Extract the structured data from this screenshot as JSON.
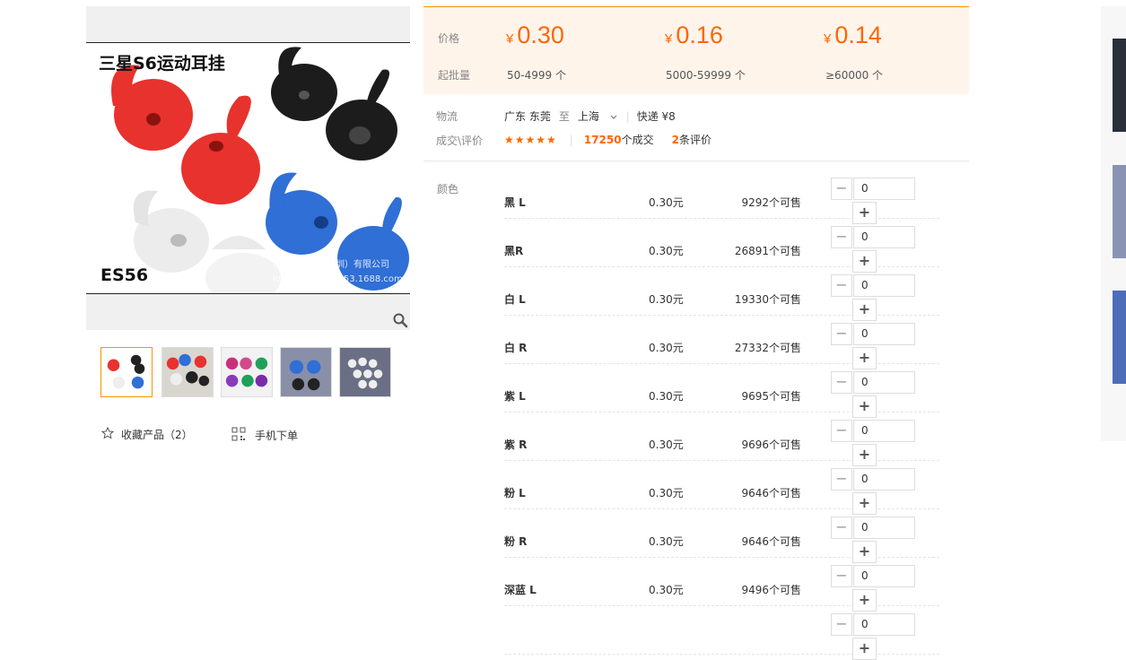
{
  "gallery": {
    "main_title": "三星S6运动耳挂",
    "main_code": "ES56",
    "watermark_line1": "巴巴园科技（深圳）有限公司",
    "watermark_line2": "lop465870518353.1688.com",
    "favorite_label": "收藏产品（2）",
    "mobile_order_label": "手机下单",
    "icons": {
      "zoom": "magnifier-icon",
      "favorite": "star-outline-icon",
      "mobile": "qrcode-icon"
    }
  },
  "pricing": {
    "price_label": "价格",
    "moq_label": "起批量",
    "currency": "¥",
    "tiers": [
      {
        "price": "0.30",
        "range": "50-4999 个"
      },
      {
        "price": "0.16",
        "range": "5000-59999 个"
      },
      {
        "price": "0.14",
        "range": "≥60000 个"
      }
    ]
  },
  "logistics": {
    "label": "物流",
    "from": "广东 东莞",
    "to_word": "至",
    "to": "上海",
    "shipping": "快递 ¥8"
  },
  "deals": {
    "label": "成交\\评价",
    "stars": "★★★★★",
    "count": "17250",
    "count_suffix": "个成交",
    "reviews": "2",
    "reviews_suffix": "条评价"
  },
  "sku": {
    "label": "颜色",
    "rows": [
      {
        "name": "黑 L",
        "price": "0.30元",
        "stock": "9292个可售",
        "qty": "0"
      },
      {
        "name": "黑R",
        "price": "0.30元",
        "stock": "26891个可售",
        "qty": "0"
      },
      {
        "name": "白 L",
        "price": "0.30元",
        "stock": "19330个可售",
        "qty": "0"
      },
      {
        "name": "白 R",
        "price": "0.30元",
        "stock": "27332个可售",
        "qty": "0"
      },
      {
        "name": "紫 L",
        "price": "0.30元",
        "stock": "9695个可售",
        "qty": "0"
      },
      {
        "name": "紫 R",
        "price": "0.30元",
        "stock": "9696个可售",
        "qty": "0"
      },
      {
        "name": "粉 L",
        "price": "0.30元",
        "stock": "9646个可售",
        "qty": "0"
      },
      {
        "name": "粉 R",
        "price": "0.30元",
        "stock": "9646个可售",
        "qty": "0"
      },
      {
        "name": "深蓝 L",
        "price": "0.30元",
        "stock": "9496个可售",
        "qty": "0"
      },
      {
        "name": "",
        "price": "",
        "stock": "",
        "qty": "0"
      }
    ],
    "minus": "−",
    "plus": "+"
  },
  "colors": {
    "accent": "#ff6600",
    "border_accent": "#f39800",
    "price_bg": "#fff4ea"
  }
}
